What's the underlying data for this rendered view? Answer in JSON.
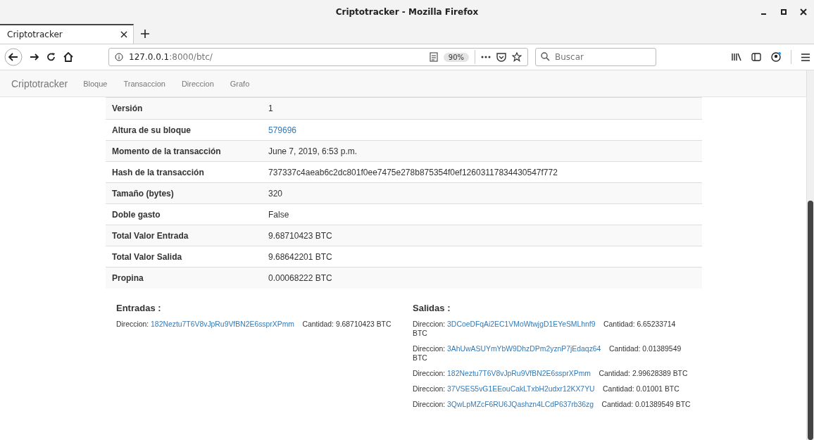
{
  "window": {
    "title": "Criptotracker - Mozilla Firefox"
  },
  "tabs": [
    {
      "label": "Criptotracker",
      "selected": true
    }
  ],
  "address_bar": {
    "host": "127.0.0.1",
    "path": ":8000/btc/",
    "zoom": "90%"
  },
  "search": {
    "placeholder": "Buscar"
  },
  "navbar": {
    "brand": "Criptotracker",
    "links": [
      "Bloque",
      "Transaccion",
      "Direccion",
      "Grafo"
    ]
  },
  "table": {
    "rows": [
      {
        "label": "Versión",
        "value": "1",
        "kind": "text"
      },
      {
        "label": "Altura de su bloque",
        "value": "579696",
        "kind": "link"
      },
      {
        "label": "Momento de la transacción",
        "value": "June 7, 2019, 6:53 p.m.",
        "kind": "text"
      },
      {
        "label": "Hash de la transacción",
        "value": "737337c4aeab6c2dc801f0ee7475e278b875354f0ef12603117834430547f772",
        "kind": "text"
      },
      {
        "label": "Tamaño (bytes)",
        "value": "320",
        "kind": "text"
      },
      {
        "label": "Doble gasto",
        "value": "False",
        "kind": "text"
      },
      {
        "label": "Total Valor Entrada",
        "value": "9.68710423 BTC",
        "kind": "text"
      },
      {
        "label": "Total Valor Salida",
        "value": "9.68642201 BTC",
        "kind": "text"
      },
      {
        "label": "Propina",
        "value": "0.00068222 BTC",
        "kind": "text"
      }
    ]
  },
  "inputs": {
    "title": "Entradas :",
    "entries": [
      {
        "label": "Direccion:",
        "address": "182Neztu7T6V8vJpRu9VfBN2E6ssprXPmm",
        "amount": "Cantidad: 9.68710423 BTC"
      }
    ]
  },
  "outputs": {
    "title": "Salidas :",
    "entries": [
      {
        "label": "Direccion:",
        "address": "3DCoeDFqAi2EC1VMoWtwjgD1EYeSMLhnf9",
        "amount": "Cantidad: 6.65233714 BTC"
      },
      {
        "label": "Direccion:",
        "address": "3AhUwASUYmYbW9DhzDPm2yznP7jEdaqz64",
        "amount": "Cantidad: 0.01389549 BTC"
      },
      {
        "label": "Direccion:",
        "address": "182Neztu7T6V8vJpRu9VfBN2E6ssprXPmm",
        "amount": "Cantidad: 2.99628389 BTC"
      },
      {
        "label": "Direccion:",
        "address": "37VSES5vG1EEouCakLTxbH2udxr12KX7YU",
        "amount": "Cantidad: 0.01001 BTC"
      },
      {
        "label": "Direccion:",
        "address": "3QwLpMZcF6RU6JQashzn4LCdP637rb36zg",
        "amount": "Cantidad: 0.01389549 BTC"
      }
    ]
  }
}
